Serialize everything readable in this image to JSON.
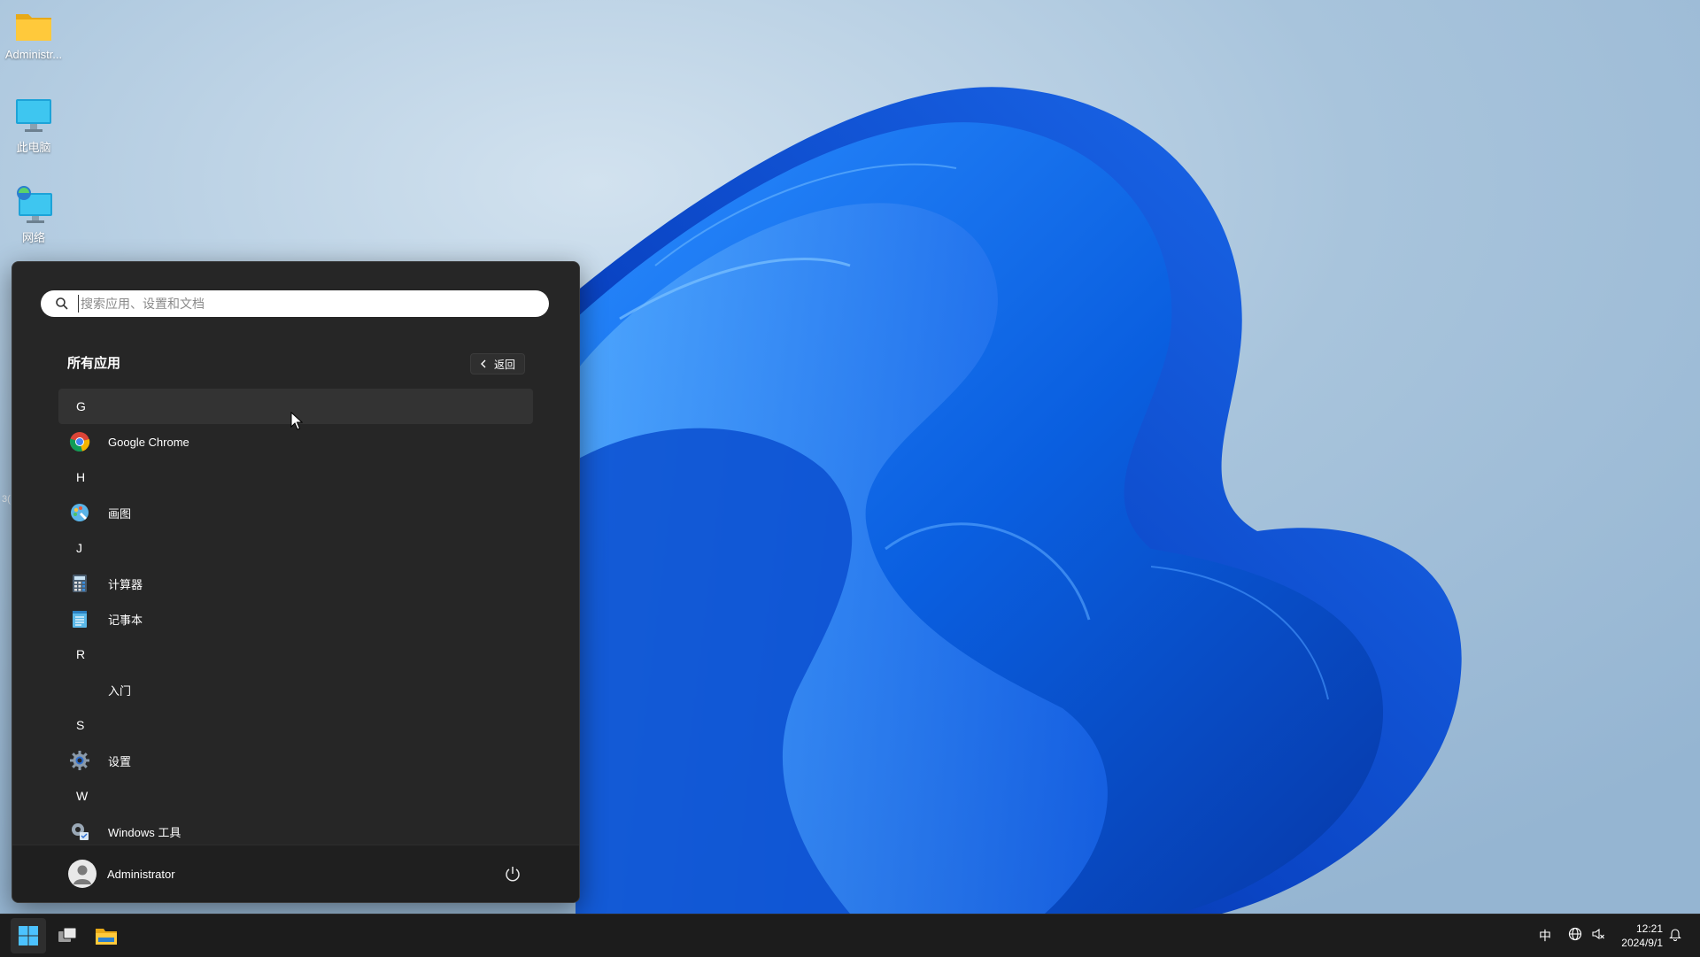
{
  "desktop": {
    "icons": [
      {
        "label": "Administr...",
        "icon": "folder-icon"
      },
      {
        "label": "此电脑",
        "icon": "computer-icon"
      },
      {
        "label": "网络",
        "icon": "network-icon"
      }
    ],
    "edge_text": "3("
  },
  "start_menu": {
    "search": {
      "placeholder": "搜索应用、设置和文档"
    },
    "header": {
      "title": "所有应用",
      "back_label": "返回"
    },
    "list": [
      {
        "kind": "letter",
        "label": "G"
      },
      {
        "kind": "app",
        "label": "Google Chrome",
        "icon": "chrome-icon"
      },
      {
        "kind": "letter",
        "label": "H"
      },
      {
        "kind": "app",
        "label": "画图",
        "icon": "paint-icon"
      },
      {
        "kind": "letter",
        "label": "J"
      },
      {
        "kind": "app",
        "label": "计算器",
        "icon": "calculator-icon"
      },
      {
        "kind": "app",
        "label": "记事本",
        "icon": "notepad-icon"
      },
      {
        "kind": "letter",
        "label": "R"
      },
      {
        "kind": "app",
        "label": "入门",
        "icon": "blank-icon"
      },
      {
        "kind": "letter",
        "label": "S"
      },
      {
        "kind": "app",
        "label": "设置",
        "icon": "settings-gear-icon"
      },
      {
        "kind": "letter",
        "label": "W"
      },
      {
        "kind": "app",
        "label": "Windows 工具",
        "icon": "windows-tools-icon"
      }
    ],
    "user": {
      "name": "Administrator"
    }
  },
  "taskbar": {
    "ime": "中",
    "clock": {
      "time": "12:21",
      "date": "2024/9/1"
    }
  },
  "colors": {
    "menu_bg": "#262626",
    "taskbar_bg": "#1c1c1c",
    "accent": "#0a63d6"
  }
}
